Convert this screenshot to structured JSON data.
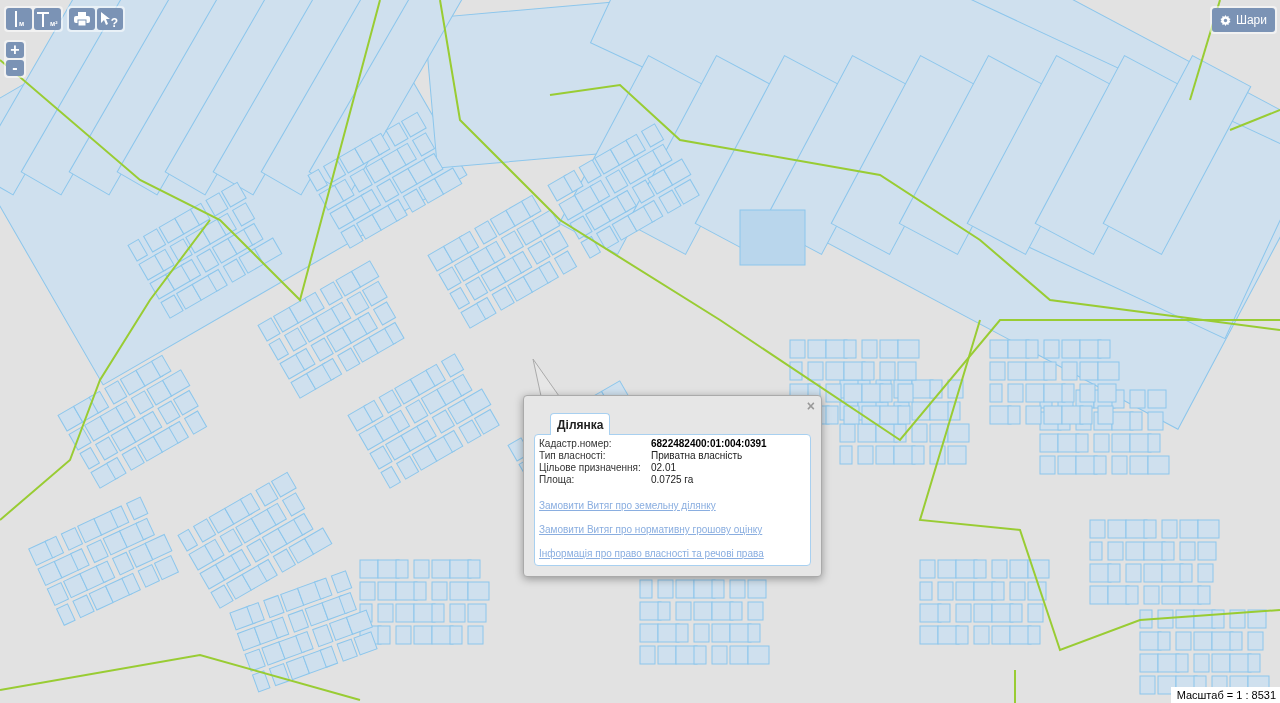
{
  "toolbar": {
    "groups": [
      [
        {
          "kind": "distance",
          "label": "м"
        },
        {
          "kind": "area",
          "label": "м²"
        }
      ],
      [
        {
          "kind": "print"
        },
        {
          "kind": "identify",
          "label": "?"
        }
      ]
    ]
  },
  "zoom_buttons": [
    "+",
    "-"
  ],
  "layers_button": {
    "label": "Шари"
  },
  "popup": {
    "close": "×",
    "tabs": [
      {
        "label": "Ділянка",
        "selected": true
      }
    ],
    "fields": [
      {
        "label": "Кадастр.номер:",
        "value": "6822482400:01:004:0391",
        "bold": true
      },
      {
        "label": "Тип власності:",
        "value": "Приватна власність",
        "bold": false
      },
      {
        "label": "Цільове призначення:",
        "value": "02.01",
        "bold": false
      },
      {
        "label": "Площа:",
        "value": "0.0725 га",
        "bold": false
      }
    ],
    "links": [
      "Замовити Витяг про земельну ділянку",
      "Замовити Витяг про нормативну грошову оцінку",
      "Інформація про право власності та речові права"
    ]
  },
  "scale": "Масштаб = 1 : 8531"
}
